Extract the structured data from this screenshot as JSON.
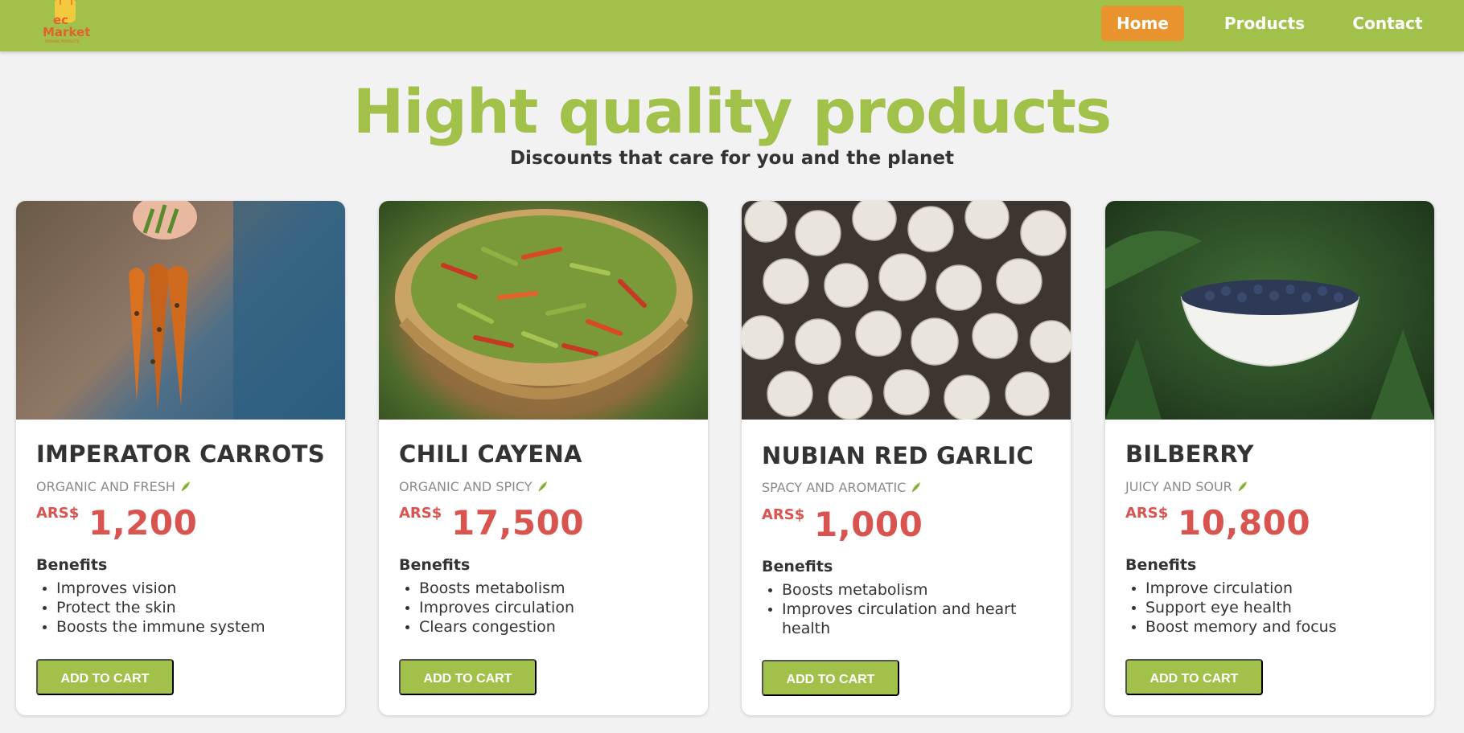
{
  "header": {
    "logo": {
      "line1": "ec",
      "line2": "Market",
      "tagline": "ORGANIC PRODUCTS"
    },
    "nav": [
      {
        "label": "Home",
        "active": true
      },
      {
        "label": "Products",
        "active": false
      },
      {
        "label": "Contact",
        "active": false
      }
    ]
  },
  "hero": {
    "title": "Hight quality products",
    "subtitle": "Discounts that care for you and the planet"
  },
  "colors": {
    "brand_green": "#a2c14a",
    "accent_orange": "#e8932d",
    "price_red": "#d9534f"
  },
  "products": [
    {
      "title": "IMPERATOR CARROTS",
      "tagline": "ORGANIC AND FRESH",
      "currency": "ARS$",
      "price": "1,200",
      "benefits_title": "Benefits",
      "benefits": [
        "Improves vision",
        "Protect the skin",
        "Boosts the immune system"
      ],
      "button": "ADD TO CART",
      "image": "carrots-photo"
    },
    {
      "title": "CHILI CAYENA",
      "tagline": "ORGANIC AND SPICY",
      "currency": "ARS$",
      "price": "17,500",
      "benefits_title": "Benefits",
      "benefits": [
        "Boosts metabolism",
        "Improves circulation",
        "Clears congestion"
      ],
      "button": "ADD TO CART",
      "image": "chili-basket-photo"
    },
    {
      "title": "NUBIAN RED GARLIC",
      "tagline": "SPACY AND AROMATIC",
      "currency": "ARS$",
      "price": "1,000",
      "benefits_title": "Benefits",
      "benefits": [
        "Boosts metabolism",
        "Improves circulation and heart health"
      ],
      "button": "ADD TO CART",
      "image": "garlic-photo"
    },
    {
      "title": "BILBERRY",
      "tagline": "JUICY AND SOUR",
      "currency": "ARS$",
      "price": "10,800",
      "benefits_title": "Benefits",
      "benefits": [
        "Improve circulation",
        "Support eye health",
        "Boost memory and focus"
      ],
      "button": "ADD TO CART",
      "image": "bilberry-bowl-photo"
    }
  ]
}
